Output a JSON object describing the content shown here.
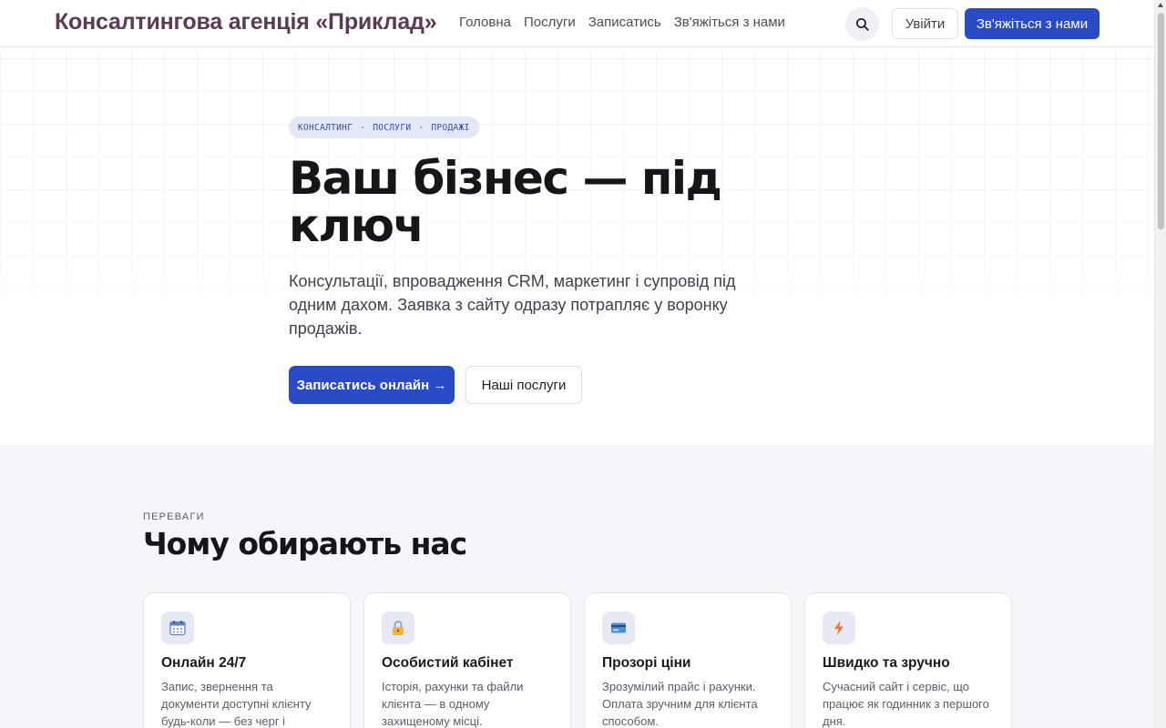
{
  "header": {
    "brand": "Консалтингова агенція «Приклад»",
    "nav": [
      "Головна",
      "Послуги",
      "Записатись",
      "Зв'яжіться з нами"
    ],
    "search_icon": "search-icon",
    "login_label": "Увійти",
    "contact_label": "Зв'яжіться з нами"
  },
  "hero": {
    "tags": [
      "КОНСАЛТИНГ",
      "ПОСЛУГИ",
      "ПРОДАЖІ"
    ],
    "tag_separator": "·",
    "title": "Ваш бізнес — під ключ",
    "subtitle": "Консультації, впровадження CRM, маркетинг і супровід під одним дахом. Заявка з сайту одразу потрапляє у воронку продажів.",
    "primary_cta": "Записатись онлайн →",
    "secondary_cta": "Наші послуги"
  },
  "features": {
    "eyebrow": "ПЕРЕВАГИ",
    "title": "Чому обирають нас",
    "cards": [
      {
        "icon": "calendar-icon",
        "title": "Онлайн 24/7",
        "text": "Запис, звернення та документи доступні клієнту будь-коли — без черг і дзвінків."
      },
      {
        "icon": "lock-icon",
        "title": "Особистий кабінет",
        "text": "Історія, рахунки та файли клієнта — в одному захищеному місці."
      },
      {
        "icon": "credit-card-icon",
        "title": "Прозорі ціни",
        "text": "Зрозумілий прайс і рахунки. Оплата зручним для клієнта способом."
      },
      {
        "icon": "lightning-icon",
        "title": "Швидко та зручно",
        "text": "Сучасний сайт і сервіс, що працює як годинник з першого дня."
      }
    ]
  },
  "colors": {
    "accent": "#2a4bc8",
    "brand": "#5b3a55",
    "section_bg": "#f5f6f9"
  }
}
